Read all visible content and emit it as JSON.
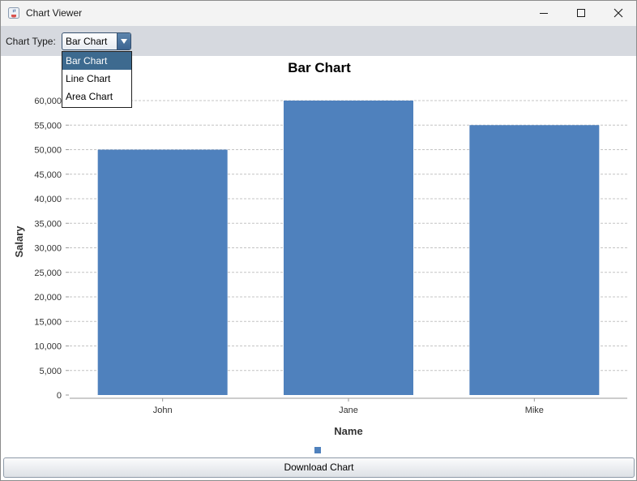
{
  "window": {
    "title": "Chart Viewer"
  },
  "toolbar": {
    "chart_type_label": "Chart Type:",
    "selected": "Bar Chart",
    "options": [
      "Bar Chart",
      "Line Chart",
      "Area Chart"
    ]
  },
  "footer": {
    "download_label": "Download Chart"
  },
  "colors": {
    "bar": "#4f81bd",
    "grid": "#c4c4c4",
    "toolbar": "#d6d9df",
    "selection": "#3d6a8f"
  },
  "chart_data": {
    "type": "bar",
    "title": "Bar Chart",
    "xlabel": "Name",
    "ylabel": "Salary",
    "categories": [
      "John",
      "Jane",
      "Mike"
    ],
    "values": [
      50000,
      60000,
      55000
    ],
    "ylim": [
      0,
      60000
    ],
    "yticks": [
      0,
      5000,
      10000,
      15000,
      20000,
      25000,
      30000,
      35000,
      40000,
      45000,
      50000,
      55000,
      60000
    ],
    "ytick_labels": [
      "0",
      "5,000",
      "10,000",
      "15,000",
      "20,000",
      "25,000",
      "30,000",
      "35,000",
      "40,000",
      "45,000",
      "50,000",
      "55,000",
      "60,000"
    ],
    "grid": true,
    "legend": "bottom"
  }
}
